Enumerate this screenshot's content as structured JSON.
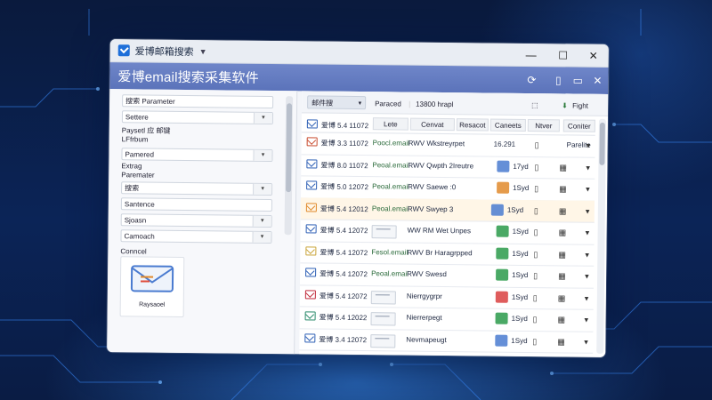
{
  "window": {
    "tab_title": "爱博邮箱搜索",
    "app_title": "爱博email搜索采集软件",
    "controls": {
      "minimize": "—",
      "maximize": "☐",
      "close": "✕"
    }
  },
  "left_panel": {
    "fields": [
      {
        "label": "",
        "value": "搜索 Parameter",
        "dropdown": false
      },
      {
        "label": "",
        "value": "Settere",
        "dropdown": true
      },
      {
        "label": "Paysetl 应 邮键\nLFfrbum",
        "value": "",
        "dropdown": false
      },
      {
        "label": "",
        "value": "Pamered",
        "dropdown": true
      },
      {
        "label": "Extrag\nParemater",
        "value": "",
        "dropdown": false
      },
      {
        "label": "",
        "value": "搜索",
        "dropdown": true
      },
      {
        "label": "",
        "value": "Santence",
        "dropdown": false
      },
      {
        "label": "",
        "value": "Sjoasn",
        "dropdown": true
      },
      {
        "label": "",
        "value": "Camoach",
        "dropdown": true
      }
    ],
    "preview_heading": "Conncel",
    "preview_label": "Raysaoel"
  },
  "toolbar": {
    "dropdown": "邮件搜",
    "text1": "Paraced",
    "text2": "13800 hrapl",
    "right_label": "Fight"
  },
  "table": {
    "headers": [
      "Lete",
      "Cenvat",
      "Resacot",
      "Caneets",
      "Ntver",
      "Coniter"
    ],
    "rows": [
      {
        "date": "爱博 5.4 11072",
        "col1": "",
        "col2": "",
        "val": "",
        "extra": "",
        "icon_color": "#2d5fb5"
      },
      {
        "date": "爱博 3.3 11072",
        "col1": "Poocl.email",
        "col2": "RWV Wkstreyrpet",
        "val": "16.291",
        "extra": "Parelite",
        "icon_color": "#c94b2e"
      },
      {
        "date": "爱博 8.0 11072",
        "col1": "Peoal.email",
        "col2": "RWV Qwpth 2Ireutre",
        "val": "17yd",
        "extra": "",
        "icon_color": "#2d5fb5"
      },
      {
        "date": "爱博 5.0 12072",
        "col1": "Peoal.email",
        "col2": "RWV Saewe :0",
        "val": "1Syd",
        "extra": "",
        "icon_color": "#2d5fb5"
      },
      {
        "date": "爱博 5.4 12012",
        "col1": "Peoal.email",
        "col2": "RWV Swyep 3",
        "val": "1Syd",
        "extra": "",
        "icon_color": "#e0892b"
      },
      {
        "date": "爱博 5.4 12072",
        "col1": "",
        "col2": "WW RM Wet Unpes",
        "val": "1Syd",
        "extra": "",
        "icon_color": "#2d5fb5"
      },
      {
        "date": "爱博 5.4 12072",
        "col1": "Fesol.email",
        "col2": "RWV Br Haragrpped",
        "val": "1Syd",
        "extra": "",
        "icon_color": "#caa53a"
      },
      {
        "date": "爱博 5.4 12072",
        "col1": "Peoal.email",
        "col2": "RWV Swesd",
        "val": "1Syd",
        "extra": "",
        "icon_color": "#2d5fb5"
      },
      {
        "date": "爱博 5.4 12072",
        "col1": "",
        "col2": "Nierrgygrpr",
        "val": "1Syd",
        "extra": "",
        "icon_color": "#c02a3a"
      },
      {
        "date": "爱博 5.4 12022",
        "col1": "",
        "col2": "Nierrerpegt",
        "val": "1Syd",
        "extra": "",
        "icon_color": "#2a8a6a"
      },
      {
        "date": "爱博 3.4 12072",
        "col1": "",
        "col2": "Nevmapeugt",
        "val": "1Syd",
        "extra": "",
        "icon_color": "#2d5fb5"
      }
    ]
  },
  "colors": {
    "ribbon": "#5b73ba",
    "accent": "#1e6fd9",
    "selected_row": "#fff6e7"
  }
}
